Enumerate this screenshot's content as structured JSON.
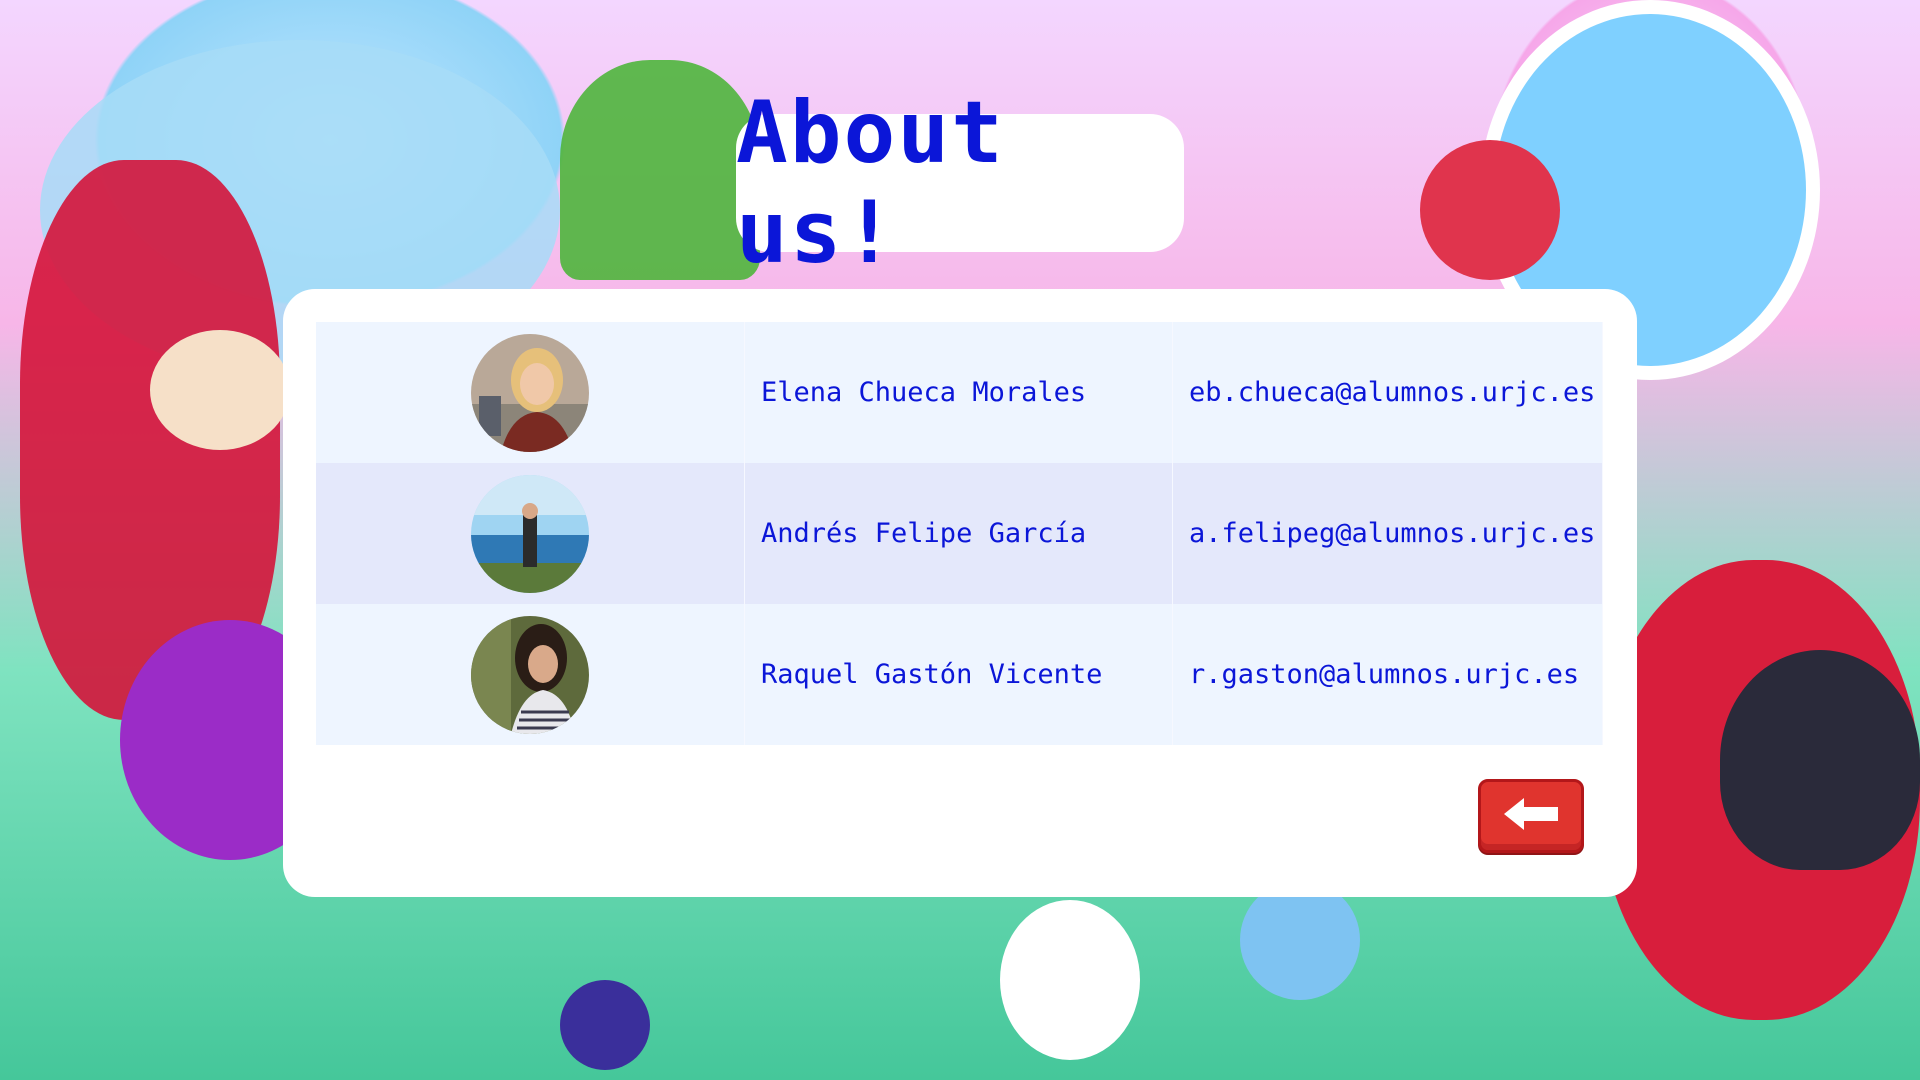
{
  "page": {
    "title": "About us!",
    "back_icon": "arrow-left-icon",
    "colors": {
      "title_text": "#0b16d8",
      "table_text": "#0b16d8",
      "row_light": "#eef5ff",
      "row_alt": "#e4e8fb",
      "back_button": "#e0342e"
    }
  },
  "team": {
    "members": [
      {
        "name": "Elena Chueca Morales",
        "email": "eb.chueca@alumnos.urjc.es"
      },
      {
        "name": "Andrés Felipe García",
        "email": "a.felipeg@alumnos.urjc.es"
      },
      {
        "name": "Raquel Gastón Vicente",
        "email": "r.gaston@alumnos.urjc.es"
      }
    ]
  }
}
